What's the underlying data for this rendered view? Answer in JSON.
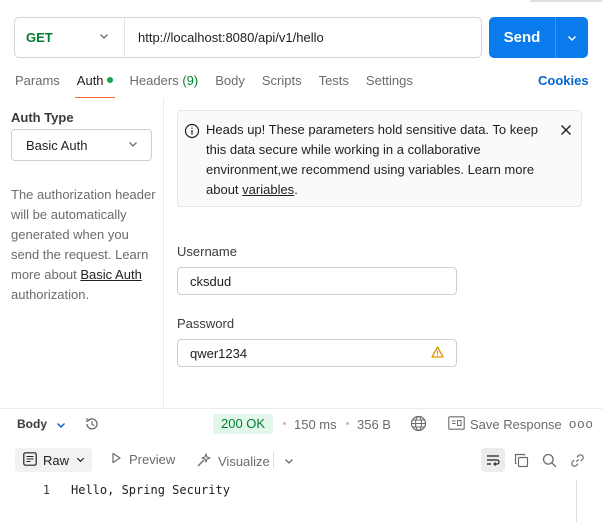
{
  "request": {
    "method": "GET",
    "url": "http://localhost:8080/api/v1/hello",
    "send_label": "Send"
  },
  "tabs": [
    {
      "label": "Params"
    },
    {
      "label": "Auth",
      "active": true
    },
    {
      "label": "Headers",
      "count": "(9)"
    },
    {
      "label": "Body"
    },
    {
      "label": "Scripts"
    },
    {
      "label": "Tests"
    },
    {
      "label": "Settings"
    }
  ],
  "cookies_label": "Cookies",
  "auth": {
    "type_label": "Auth Type",
    "type_value": "Basic Auth",
    "description": "The authorization header will be automatically generated when you send the request. Learn more about ",
    "link_text": "Basic Auth",
    "description_end": " authorization."
  },
  "banner": {
    "text": "Heads up! These parameters hold sensitive data. To keep this data secure while working in a collaborative environment,we recommend using variables. Learn more about ",
    "link_text": "variables",
    "text_end": "."
  },
  "fields": {
    "username_label": "Username",
    "username_value": "cksdud",
    "password_label": "Password",
    "password_value": "qwer1234"
  },
  "response": {
    "body_label": "Body",
    "status": "200 OK",
    "time": "150 ms",
    "size": "356 B",
    "save_label": "Save Response",
    "more": "ooo",
    "view_raw": "Raw",
    "view_preview": "Preview",
    "view_visualize": "Visualize",
    "lines": [
      {
        "no": "1",
        "text": "Hello, Spring Security"
      }
    ]
  },
  "colors": {
    "accent": "#097bed",
    "method_get": "#007f31",
    "tab_underline": "#ff6c37",
    "warning": "#d99a00"
  }
}
